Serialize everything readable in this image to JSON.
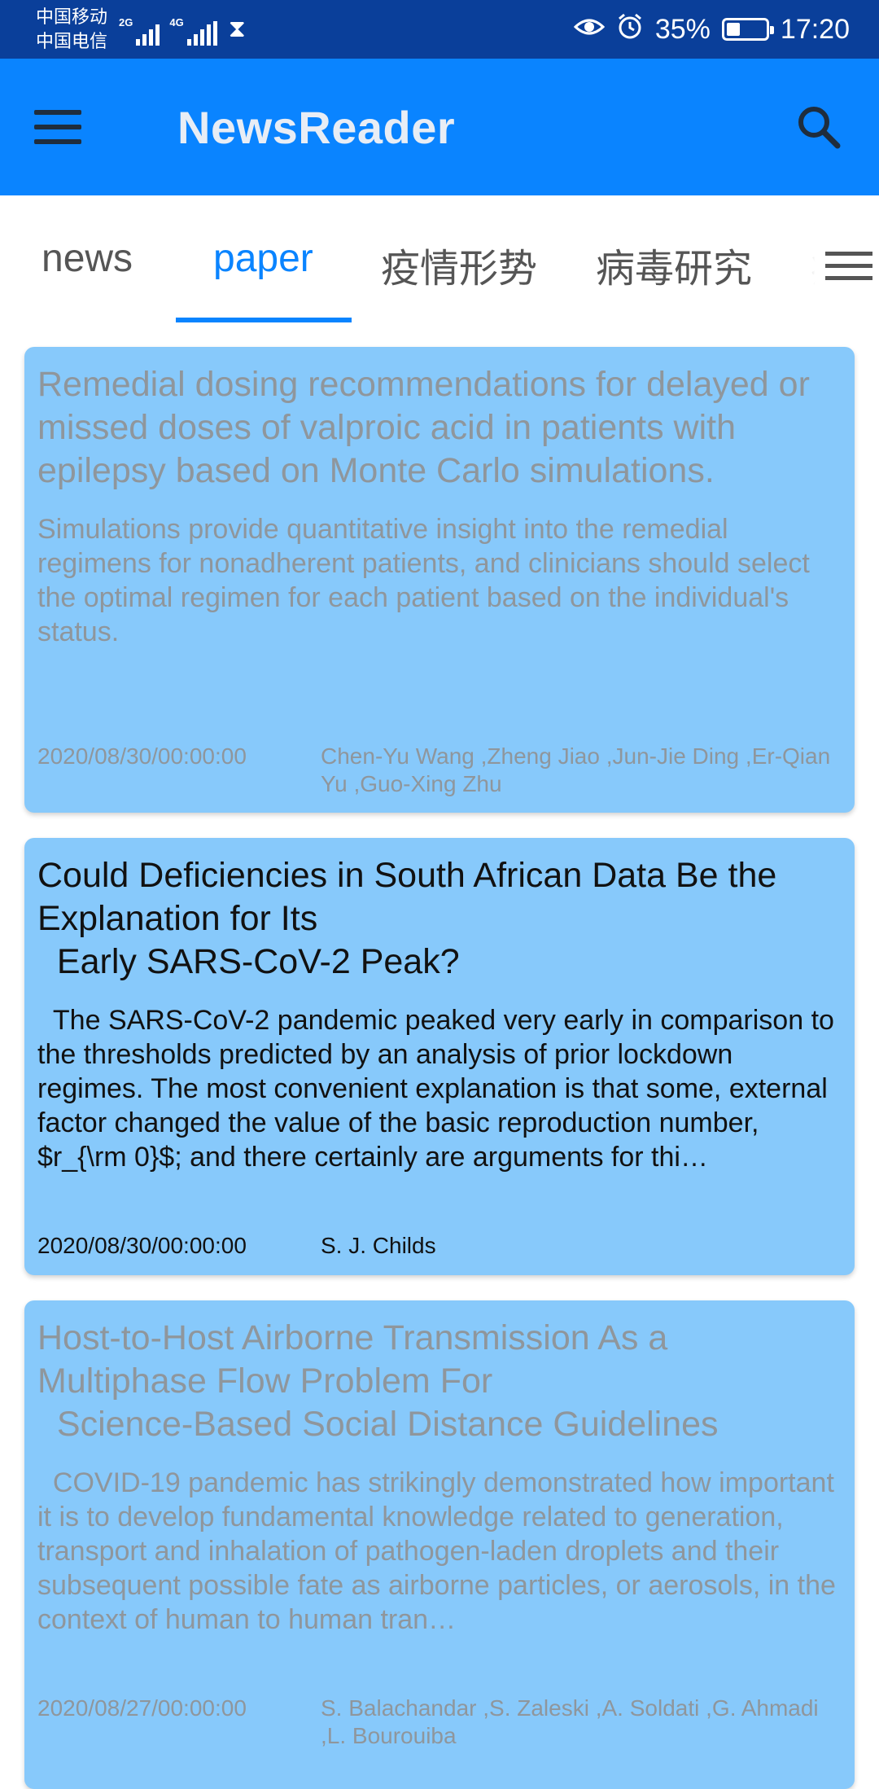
{
  "status_bar": {
    "carrier_1": "中国移动",
    "carrier_2": "中国电信",
    "net_1": "2G",
    "net_2": "4G",
    "battery": "35%",
    "battery_level": 0.35,
    "time": "17:20",
    "icons": [
      "eye-icon",
      "alarm-icon",
      "hourglass-icon",
      "signal-icon",
      "battery-icon"
    ]
  },
  "app_bar": {
    "title": "NewsReader",
    "menu_icon": "menu-icon",
    "search_icon": "search-icon"
  },
  "tabs": {
    "items": [
      {
        "label": "news"
      },
      {
        "label": "paper"
      },
      {
        "label": "疫情形势"
      },
      {
        "label": "病毒研究"
      },
      {
        "label": "疫"
      }
    ],
    "active_index": 1,
    "more_icon": "more-list-icon"
  },
  "cards": [
    {
      "title": "Remedial dosing recommendations for delayed or missed doses of valproic acid in patients with epilepsy based on Monte Carlo simulations.",
      "abstract": "Simulations provide quantitative insight into the remedial regimens for nonadherent patients, and clinicians should select the optimal regimen for each patient based on the individual's status.",
      "date": "2020/08/30/00:00:00",
      "authors": "Chen-Yu Wang ,Zheng Jiao ,Jun-Jie Ding ,Er-Qian Yu ,Guo-Xing Zhu",
      "read": true
    },
    {
      "title": "Could Deficiencies in South African Data Be the Explanation for Its\n  Early SARS-CoV-2 Peak?",
      "abstract": "  The SARS-CoV-2 pandemic peaked very early in comparison to the thresholds predicted by an analysis of prior lockdown regimes. The most convenient explanation is that some, external factor changed the value of the basic reproduction number, $r_{\\rm 0}$; and there certainly are arguments for thi…",
      "date": "2020/08/30/00:00:00",
      "authors": "S. J. Childs",
      "read": false
    },
    {
      "title": "Host-to-Host Airborne Transmission As a Multiphase Flow Problem For\n  Science-Based Social Distance Guidelines",
      "abstract": "  COVID-19 pandemic has strikingly demonstrated how important it is to develop fundamental knowledge related to generation, transport and inhalation of pathogen-laden droplets and their subsequent possible fate as airborne particles, or aerosols, in the context of human to human tran…",
      "date": "2020/08/27/00:00:00",
      "authors": "S. Balachandar ,S. Zaleski ,A. Soldati ,G. Ahmadi ,L. Bourouiba",
      "read": true
    }
  ],
  "colors": {
    "status_bar": "#0a3f9a",
    "app_bar": "#0a84ff",
    "accent": "#0a84ff",
    "card_bg": "#87c9fb",
    "read_text": "#8f969c",
    "unread_text": "#111111"
  }
}
